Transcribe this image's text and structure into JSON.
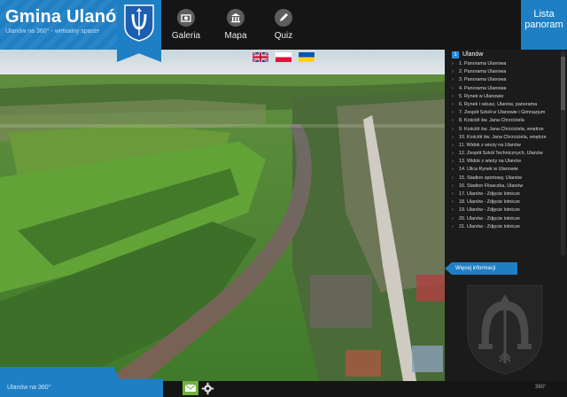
{
  "header": {
    "title": "Gmina Ulanów",
    "subtitle": "Ulanów na 360° - wirtualny spacer",
    "nav": [
      {
        "label": "Galeria",
        "icon": "gallery-icon"
      },
      {
        "label": "Mapa",
        "icon": "bank-icon"
      },
      {
        "label": "Quiz",
        "icon": "pencil-icon"
      }
    ],
    "lista_label": "Lista panoram"
  },
  "languages": [
    {
      "code": "en",
      "icon": "uk-flag-icon"
    },
    {
      "code": "pl",
      "icon": "poland-flag-icon"
    },
    {
      "code": "ua",
      "icon": "ukraine-flag-icon"
    }
  ],
  "sidebar": {
    "list_title": "Ulanów",
    "list_number": "1",
    "items": [
      "1. Panorama Ulanowa",
      "2. Panorama Ulanowa",
      "3. Panorama Ulanowa",
      "4. Panorama Ulanowa",
      "5. Rynek w Ulanowie",
      "6. Rynek i ratusz, Ulanów, panorama",
      "7. Zespół Szkół w Ulanowie i Gimnazjum",
      "8. Kościół św. Jana Chrzciciela",
      "9. Kościół św. Jana Chrzciciela, wnętrze",
      "10. Kościół św. Jana Chrzciciela, wnętrze",
      "11. Widok z wieży na Ulanów",
      "12. Zespół Szkół Technicznych, Ulanów",
      "13. Widok z wieży na Ulanów",
      "14. Ulica Rynek w Ulanowie",
      "15. Stadion sportowy, Ulanów",
      "16. Stadion Flisaczka, Ulanów",
      "17. Ulanów - Zdjęcie lotnicze",
      "18. Ulanów - Zdjęcie lotnicze",
      "19. Ulanów - Zdjęcie lotnicze",
      "20. Ulanów - Zdjęcie lotnicze",
      "21. Ulanów - Zdjęcie lotnicze"
    ],
    "more_label": "Więcej informacji"
  },
  "footer": {
    "label": "Ulanów na 360°",
    "logo_text": "360°"
  },
  "colors": {
    "accent": "#1f7fc4",
    "mail": "#6fb23d",
    "bar": "#151515"
  }
}
